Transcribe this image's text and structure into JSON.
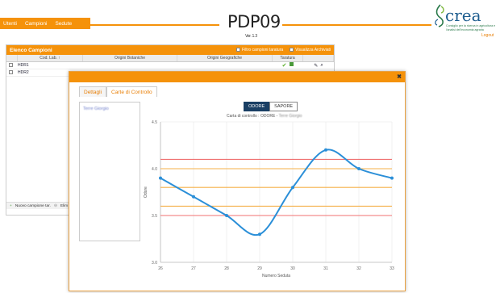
{
  "nav": {
    "items": [
      "Utenti",
      "Campioni",
      "Sedute"
    ]
  },
  "logo": {
    "title": "PDP09",
    "version": "Ver. 1.3"
  },
  "brand": {
    "word": "crea",
    "subtitle": "Consiglio per la ricerca in agricoltura e l'analisi dell'economia agraria",
    "logout": "Logout"
  },
  "list_panel": {
    "title": "Elenco Campioni",
    "filter_label": "Filtro campioni taratura",
    "archive_label": "Visualizza Archiviati",
    "columns": [
      "Cod. Lab. ↑",
      "Origini Botaniche",
      "Origini Geografiche",
      "Taratura"
    ],
    "rows": [
      {
        "code": "HDR1"
      },
      {
        "code": "HDR2"
      }
    ],
    "footer_new": "Nuovo campione tar.",
    "footer_del": "Elim"
  },
  "modal": {
    "tabs": [
      "Dettagli",
      "Carte di Controllo"
    ],
    "left_item": "Terre Giorgio",
    "toggles": [
      "ODORE",
      "SAPORE"
    ],
    "close": "✖"
  },
  "colors": {
    "accent": "#f5920a",
    "line": "#2b8fd8",
    "limit_red": "#f07070",
    "limit_orange": "#f5b048",
    "toggle_on": "#1a3f64"
  },
  "chart_data": {
    "type": "line",
    "title": "Carta di controllo : ODORE - ",
    "title_blurred": "Terre Giorgio",
    "xlabel": "Numero Seduta",
    "ylabel": "Odore",
    "x": [
      26,
      27,
      28,
      29,
      30,
      31,
      32,
      33
    ],
    "values": [
      3.9,
      3.7,
      3.5,
      3.3,
      3.8,
      4.2,
      4.0,
      3.9
    ],
    "xlim": [
      26,
      33
    ],
    "ylim": [
      3.0,
      4.5
    ],
    "yticks": [
      "3.0",
      "3.5",
      "4.0",
      "4.5"
    ],
    "limits": [
      {
        "y": 4.1,
        "color": "red"
      },
      {
        "y": 4.0,
        "color": "orange"
      },
      {
        "y": 3.8,
        "color": "orange"
      },
      {
        "y": 3.6,
        "color": "orange"
      },
      {
        "y": 3.5,
        "color": "red"
      }
    ],
    "grid": true
  }
}
